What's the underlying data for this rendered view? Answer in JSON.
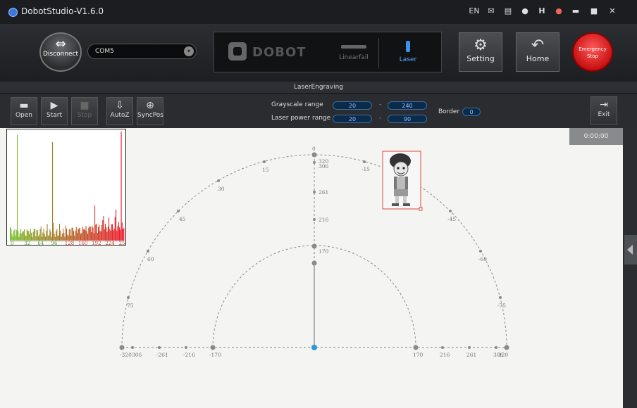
{
  "window": {
    "title": "DobotStudio-V1.6.0",
    "icons": [
      "EN",
      "mail-icon",
      "doc-icon",
      "help-icon",
      "H",
      "user-icon",
      "minimize-icon",
      "maximize-icon",
      "close-icon"
    ]
  },
  "toolbar": {
    "disconnect_label": "Disconnect",
    "port_value": "COM5",
    "device_name": "DOBOT",
    "linear_rail_label": "Linearfail",
    "laser_label": "Laser",
    "setting_label": "Setting",
    "home_label": "Home",
    "estop_line1": "Emergency",
    "estop_line2": "Stop"
  },
  "subtitle": "LaserEngraving",
  "laser_toolbar": {
    "open_label": "Open",
    "start_label": "Start",
    "stop_label": "Stop",
    "autoz_label": "AutoZ",
    "syncpos_label": "SyncPos",
    "grayscale_label": "Grayscale  range",
    "grayscale_min": "20",
    "grayscale_max": "240",
    "power_label": "Laser power range",
    "power_min": "20",
    "power_max": "90",
    "dash": "-",
    "border_label": "Border",
    "border_value": "0",
    "exit_label": "Exit"
  },
  "timer": "0:00:00",
  "histogram": {
    "x_ticks": [
      "0",
      "32",
      "64",
      "96",
      "128",
      "160",
      "192",
      "224",
      "256"
    ]
  },
  "workspace": {
    "outer_angle_labels": [
      "0",
      "15",
      "30",
      "45",
      "60",
      "75",
      "-15",
      "-30",
      "-45",
      "-60",
      "-75"
    ],
    "center_labels": [
      "320",
      "306",
      "261",
      "216",
      "170"
    ],
    "x_labels_left": [
      "-320",
      "306",
      "-261",
      "-216",
      "-170"
    ],
    "x_labels_right": [
      "170",
      "216",
      "261",
      "306",
      "320"
    ],
    "colors": {
      "origin": "#2b9ad6",
      "frame": "#e0453b",
      "arc": "#888888"
    }
  }
}
